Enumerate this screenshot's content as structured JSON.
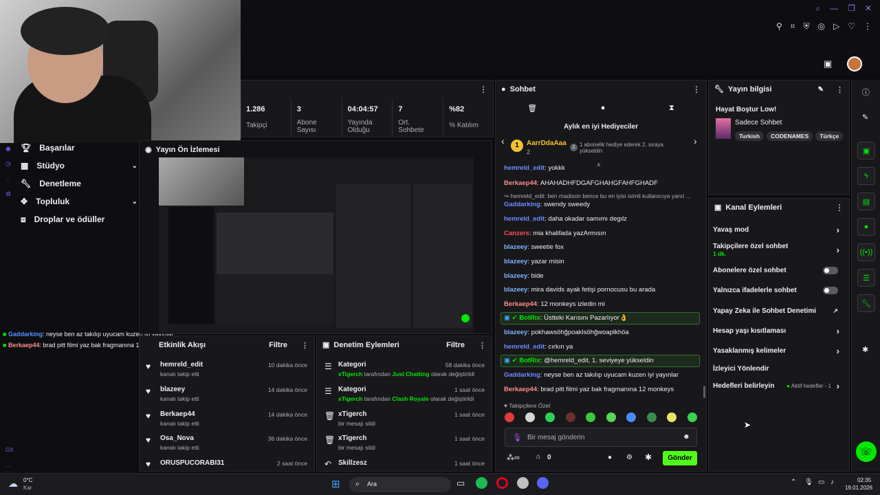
{
  "stats": [
    {
      "value": "1.286",
      "label": "Takipçi"
    },
    {
      "value": "3",
      "label": "Abone Sayısı"
    },
    {
      "value": "04:04:57",
      "label": "Yayında Olduğu"
    },
    {
      "value": "7",
      "label": "Ort. Sohbete"
    },
    {
      "value": "%82",
      "label": "% Katılım"
    }
  ],
  "nav": {
    "items": [
      "Başarılar",
      "Stüdyo",
      "Denetleme",
      "Topluluk",
      "Droplar ve ödüller"
    ]
  },
  "preview": {
    "title": "Yayın Ön İzlemesi"
  },
  "overlay_chat": [
    {
      "user": "Gaddarking",
      "text": ": neyse ben az takılıp uyucam kuzen iyi yayınlar"
    },
    {
      "user": "Berkaep44",
      "text": ": brad pitt filmi yaz bak fragmanına 12 monkeys"
    }
  ],
  "chat": {
    "title": "Sohbet",
    "gifters_title": "Aylık en iyi Hediyeciler",
    "top_gifter": {
      "name": "AarrDdaAaa",
      "count": "2",
      "rank": "1",
      "note": "1 abonelik hediye ederek 2. sıraya yükseldin",
      "note_rank": "2"
    },
    "messages": [
      {
        "user": "hemreld_edit",
        "color": "#6d8cff",
        "text": ": yokkk"
      },
      {
        "user": "Berkaep44",
        "color": "#ff8c8c",
        "text": ": AHAHADHFDGAFGHAHGFAHFGHADF"
      },
      {
        "reply": "hemreld_edit: ben madison bence bu en iyisi isimli kullanıcıya yanıt ..."
      },
      {
        "user": "Gaddarking",
        "color": "#6d8cff",
        "text": ": swendy sweedy"
      },
      {
        "user": "hemreld_edit",
        "color": "#6d8cff",
        "text": ": daha okadar samımı degılz"
      },
      {
        "user": "Canzers",
        "color": "#ff4f4f",
        "text": ": mia khalifada yazArmısın"
      },
      {
        "user": "blazeey",
        "color": "#7cb4ff",
        "text": ": sweetie fox"
      },
      {
        "user": "blazeey",
        "color": "#7cb4ff",
        "text": ": yazar misin"
      },
      {
        "user": "blazeey",
        "color": "#7cb4ff",
        "text": ": bide"
      },
      {
        "user": "blazeey",
        "color": "#7cb4ff",
        "text": ": mira davids ayak fetişi pornocusu bu arada"
      },
      {
        "user": "Berkaep44",
        "color": "#ff8c8c",
        "text": ": 12 monkeys izledin mi"
      },
      {
        "bot": true,
        "user": "BotRix",
        "text": ": Üstteki Karısını Pazarlıyor👌"
      },
      {
        "user": "blazeey",
        "color": "#7cb4ff",
        "text": ": pokhawsöhğpoaklsöhğwoaplkhöa"
      },
      {
        "user": "hemreld_edit",
        "color": "#6d8cff",
        "text": ": cırkın ya"
      },
      {
        "bot": true,
        "user": "BotRix",
        "text": ": @hemreld_edit, 1. seviyeye yükseldin"
      },
      {
        "user": "Gaddarking",
        "color": "#6d8cff",
        "text": ": neyse ben az takılıp uyucam kuzen iyi yayınlar"
      },
      {
        "user": "Berkaep44",
        "color": "#ff8c8c",
        "text": ": brad pitt filmi yaz bak fragmanına 12 monkeys"
      }
    ],
    "followers_only": "Takipçilere Özel",
    "input_placeholder": "Bir mesaj gönderin",
    "points": "0",
    "send_label": "Gönder"
  },
  "stream_info": {
    "title": "Yayın bilgisi",
    "stream_title": "Hayat Boştur Low!",
    "category": "Sadece Sohbet",
    "tags": [
      "Turkish",
      "CODENAMES",
      "Türkçe"
    ]
  },
  "channel_actions": {
    "title": "Kanal Eylemleri",
    "items": [
      {
        "label": "Yavaş mod",
        "type": "chevron"
      },
      {
        "label": "Takipçilere özel sohbet",
        "sub": "1 dk.",
        "type": "chevron"
      },
      {
        "label": "Abonelere özel sohbet",
        "type": "toggle"
      },
      {
        "label": "Yalnızca ifadelerle sohbet",
        "type": "toggle"
      },
      {
        "label": "Yapay Zeka ile Sohbet Denetimi",
        "type": "external"
      },
      {
        "label": "Hesap yaşı kısıtlaması",
        "type": "chevron"
      },
      {
        "label": "Yasaklanmış kelimeler",
        "type": "chevron"
      },
      {
        "label": "İzleyici Yönlendir",
        "type": "none"
      },
      {
        "label": "Hedefleri belirleyin",
        "badge": "Aktif hedefler - 1",
        "type": "chevron"
      }
    ]
  },
  "activity": {
    "title": "Etkinlik Akışı",
    "filter": "Filtre",
    "items": [
      {
        "name": "hemreld_edit",
        "sub": "kanalı takip etti",
        "time": "10 dakika önce"
      },
      {
        "name": "blazeey",
        "sub": "kanalı takip etti",
        "time": "14 dakika önce"
      },
      {
        "name": "Berkaep44",
        "sub": "kanalı takip etti",
        "time": "14 dakika önce"
      },
      {
        "name": "Osa_Nova",
        "sub": "kanalı takip etti",
        "time": "36 dakika önce"
      },
      {
        "name": "ORUSPUCORABI31",
        "sub": "",
        "time": "2 saat önce"
      }
    ]
  },
  "moderation": {
    "title": "Denetim Eylemleri",
    "filter": "Filtre",
    "items": [
      {
        "name": "Kategori",
        "actor": "xTigerch",
        "mid": " tarafından ",
        "target": "Just Chatting",
        "end": " olarak değiştirildi",
        "time": "58 dakika önce",
        "icon": "list"
      },
      {
        "name": "Kategori",
        "actor": "xTigerch",
        "mid": " tarafından ",
        "target": "Clash Royale",
        "end": " olarak değiştirildi",
        "time": "1 saat önce",
        "icon": "list"
      },
      {
        "name": "xTigerch",
        "sub": "bir mesajı sildi",
        "time": "1 saat önce",
        "icon": "trash"
      },
      {
        "name": "xTigerch",
        "sub": "bir mesajı sildi",
        "time": "1 saat önce",
        "icon": "trash"
      },
      {
        "name": "Skillzesz",
        "sub": "",
        "time": "1 saat önce",
        "icon": "undo"
      }
    ]
  },
  "taskbar": {
    "weather_temp": "0°C",
    "weather_text": "Kar",
    "search": "Ara",
    "time": "02:35",
    "date": "19.01.2026"
  },
  "colors": {
    "accent": "#00e700",
    "bg": "#0b0b0d",
    "panel": "#18181b"
  }
}
